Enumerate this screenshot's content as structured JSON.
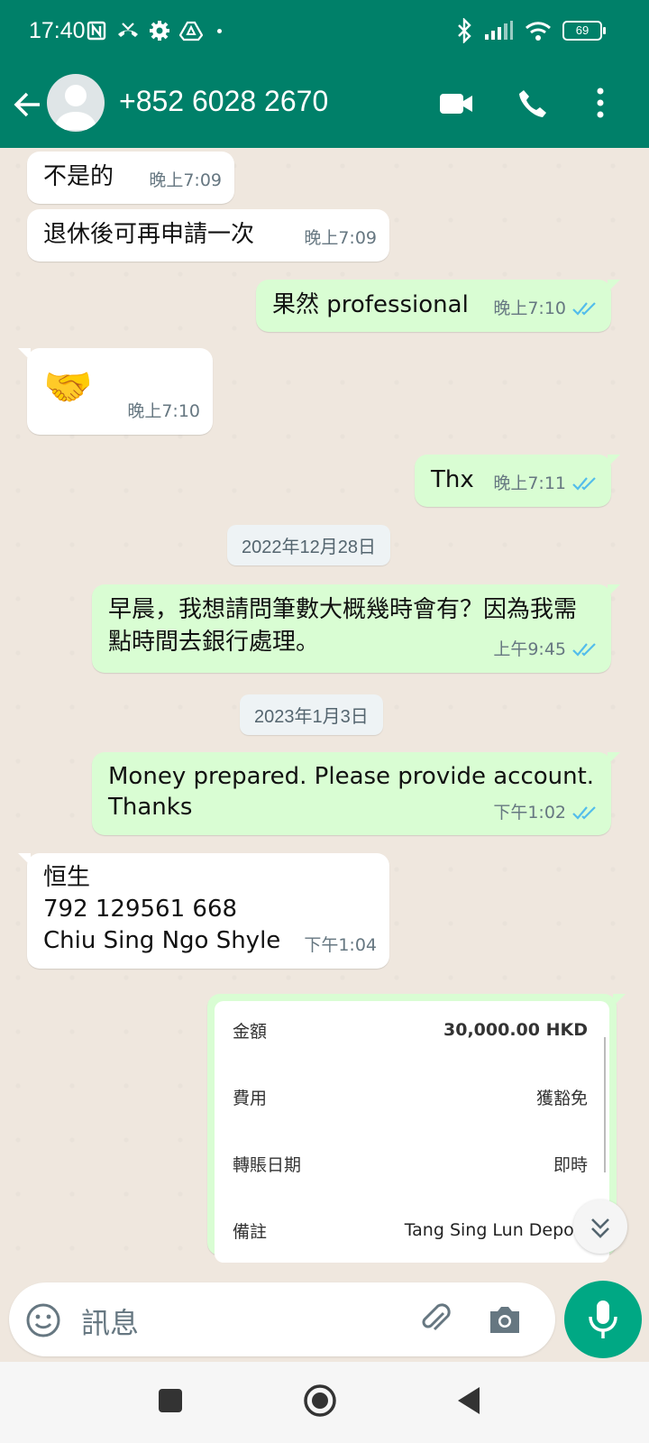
{
  "status_bar": {
    "time": "17:40",
    "battery": "69"
  },
  "header": {
    "contact_name": "+852 6028 2670"
  },
  "messages": [
    {
      "text": "不是的",
      "time": "晚上7:09",
      "side": "in"
    },
    {
      "text": "退休後可再申請一次",
      "time": "晚上7:09",
      "side": "in"
    },
    {
      "text": "果然 professional",
      "time": "晚上7:10",
      "side": "out"
    },
    {
      "text": "🤝",
      "time": "晚上7:10",
      "side": "in"
    },
    {
      "text": "Thx",
      "time": "晚上7:11",
      "side": "out"
    },
    {
      "text": "早晨，我想請問筆數大概幾時會有？因為我需點時間去銀行處理。",
      "time": "上午9:45",
      "side": "out"
    },
    {
      "text": "Money prepared. Please provide account. Thanks",
      "time": "下午1:02",
      "side": "out"
    },
    {
      "line1": "恒生",
      "line2": "792 129561 668",
      "line3": "Chiu Sing Ngo Shyle",
      "time": "下午1:04",
      "side": "in"
    }
  ],
  "date_chips": [
    "2022年12月28日",
    "2023年1月3日"
  ],
  "transfer_card": {
    "rows": [
      {
        "label": "金額",
        "value": "30,000.00 HKD"
      },
      {
        "label": "費用",
        "value": "獲豁免"
      },
      {
        "label": "轉賬日期",
        "value": "即時"
      },
      {
        "label": "備註",
        "value": "Tang Sing Lun Deposi"
      }
    ]
  },
  "input": {
    "placeholder": "訊息"
  },
  "colors": {
    "header": "#008069",
    "outgoing_bubble": "#d9fdd3",
    "incoming_bubble": "#ffffff",
    "chat_bg": "#efe7de",
    "tick_read": "#53bdeb",
    "mic_button": "#00a884"
  },
  "icons": [
    "back-arrow-icon",
    "video-call-icon",
    "phone-icon",
    "more-options-icon",
    "emoji-icon",
    "attach-icon",
    "camera-icon",
    "mic-icon",
    "scroll-down-icon",
    "nav-recents-icon",
    "nav-home-icon",
    "nav-back-icon"
  ]
}
